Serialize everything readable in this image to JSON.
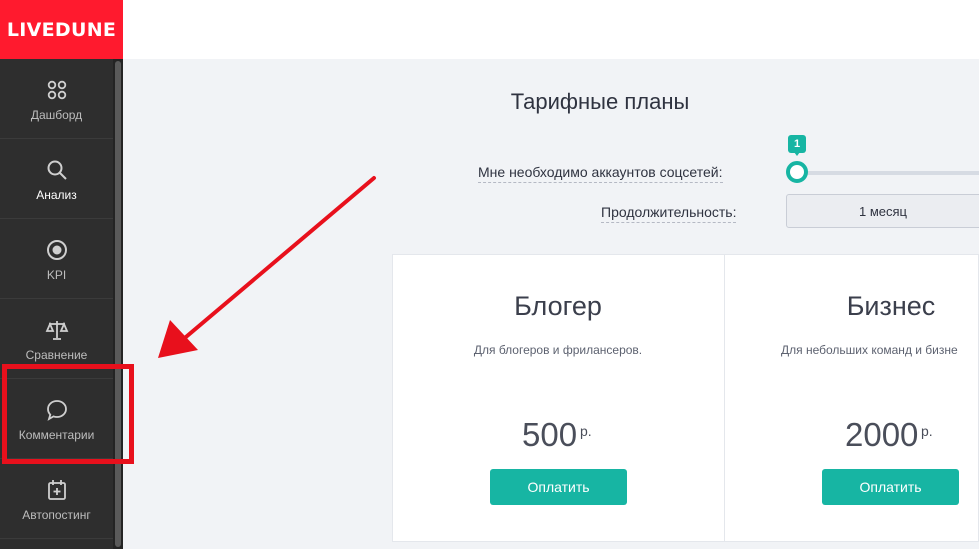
{
  "brand": {
    "logo": "LIVEDUNE",
    "color": "#ff1a2e"
  },
  "sidebar": {
    "items": [
      {
        "label": "Дашборд",
        "icon": "dashboard-icon",
        "active": false
      },
      {
        "label": "Анализ",
        "icon": "search-icon",
        "active": true
      },
      {
        "label": "KPI",
        "icon": "target-icon",
        "active": false
      },
      {
        "label": "Сравнение",
        "icon": "scales-icon",
        "active": false
      },
      {
        "label": "Комментарии",
        "icon": "comment-icon",
        "active": false
      },
      {
        "label": "Автопостинг",
        "icon": "calendar-plus-icon",
        "active": false
      }
    ]
  },
  "page": {
    "title": "Тарифные планы",
    "accounts_label": "Мне необходимо аккаунтов соцсетей:",
    "accounts_value": "1",
    "duration_label": "Продолжительность:",
    "duration_value": "1 месяц"
  },
  "plans": [
    {
      "name": "Блогер",
      "desc": "Для блогеров и фрилансеров.",
      "price": "500",
      "currency": "р.",
      "button": "Оплатить"
    },
    {
      "name": "Бизнес",
      "desc": "Для небольших команд и бизне",
      "price": "2000",
      "currency": "р.",
      "button": "Оплатить"
    }
  ],
  "colors": {
    "accent": "#17b5a3",
    "annotation": "#e8101c",
    "sidebar": "#2e2e2e"
  }
}
